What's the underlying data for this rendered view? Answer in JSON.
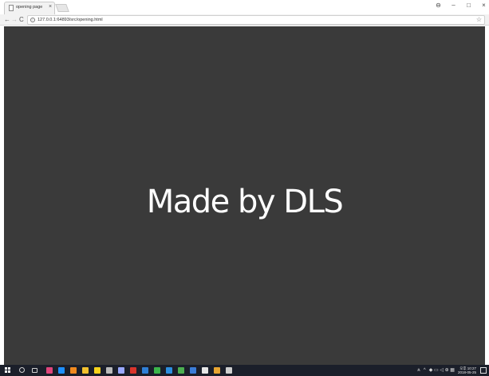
{
  "browser": {
    "tab": {
      "title": "opening page",
      "close_glyph": "×",
      "icon": "page-icon"
    },
    "window_controls": {
      "account": "⊖",
      "minimize": "–",
      "restore": "□",
      "close": "×"
    },
    "nav": {
      "back": "←",
      "forward": "→",
      "reload": "C"
    },
    "address": {
      "info": "i",
      "url": "127.0.0.1:64893/src/opening.html",
      "star": "☆"
    }
  },
  "page": {
    "headline": "Made by DLS",
    "background": "#3a3a3a",
    "text_color": "#ffffff"
  },
  "taskbar": {
    "apps": [
      {
        "name": "taskbar-app-pen",
        "color": "#e0457b"
      },
      {
        "name": "taskbar-app-edge",
        "color": "#1e90ff"
      },
      {
        "name": "taskbar-app-orange",
        "color": "#f0891e"
      },
      {
        "name": "taskbar-app-explorer",
        "color": "#f2c12e"
      },
      {
        "name": "taskbar-app-yellow",
        "color": "#f7d31b"
      },
      {
        "name": "taskbar-app-pin",
        "color": "#bbbbbb"
      },
      {
        "name": "taskbar-app-bulb",
        "color": "#9aa8ff"
      },
      {
        "name": "taskbar-app-filezilla",
        "color": "#d9342b"
      },
      {
        "name": "taskbar-app-vs",
        "color": "#2f7fd6"
      },
      {
        "name": "taskbar-app-green",
        "color": "#3bb54a"
      },
      {
        "name": "taskbar-app-blue-globe",
        "color": "#2d8fe0"
      },
      {
        "name": "taskbar-app-chrome",
        "color": "#4caf50"
      },
      {
        "name": "taskbar-app-square-blue",
        "color": "#3b7dd8"
      },
      {
        "name": "taskbar-app-white-doc",
        "color": "#e6e6e6"
      },
      {
        "name": "taskbar-app-chrome-active",
        "color": "#e8a531"
      },
      {
        "name": "taskbar-app-paint",
        "color": "#cfcfcf"
      }
    ],
    "tray": {
      "people": "ጰ",
      "chevron": "^",
      "glyphs": "◆ ▭ ◁ ⊕ ▦"
    },
    "clock": {
      "time": "오후 10:27",
      "date": "2018-05-25"
    }
  }
}
